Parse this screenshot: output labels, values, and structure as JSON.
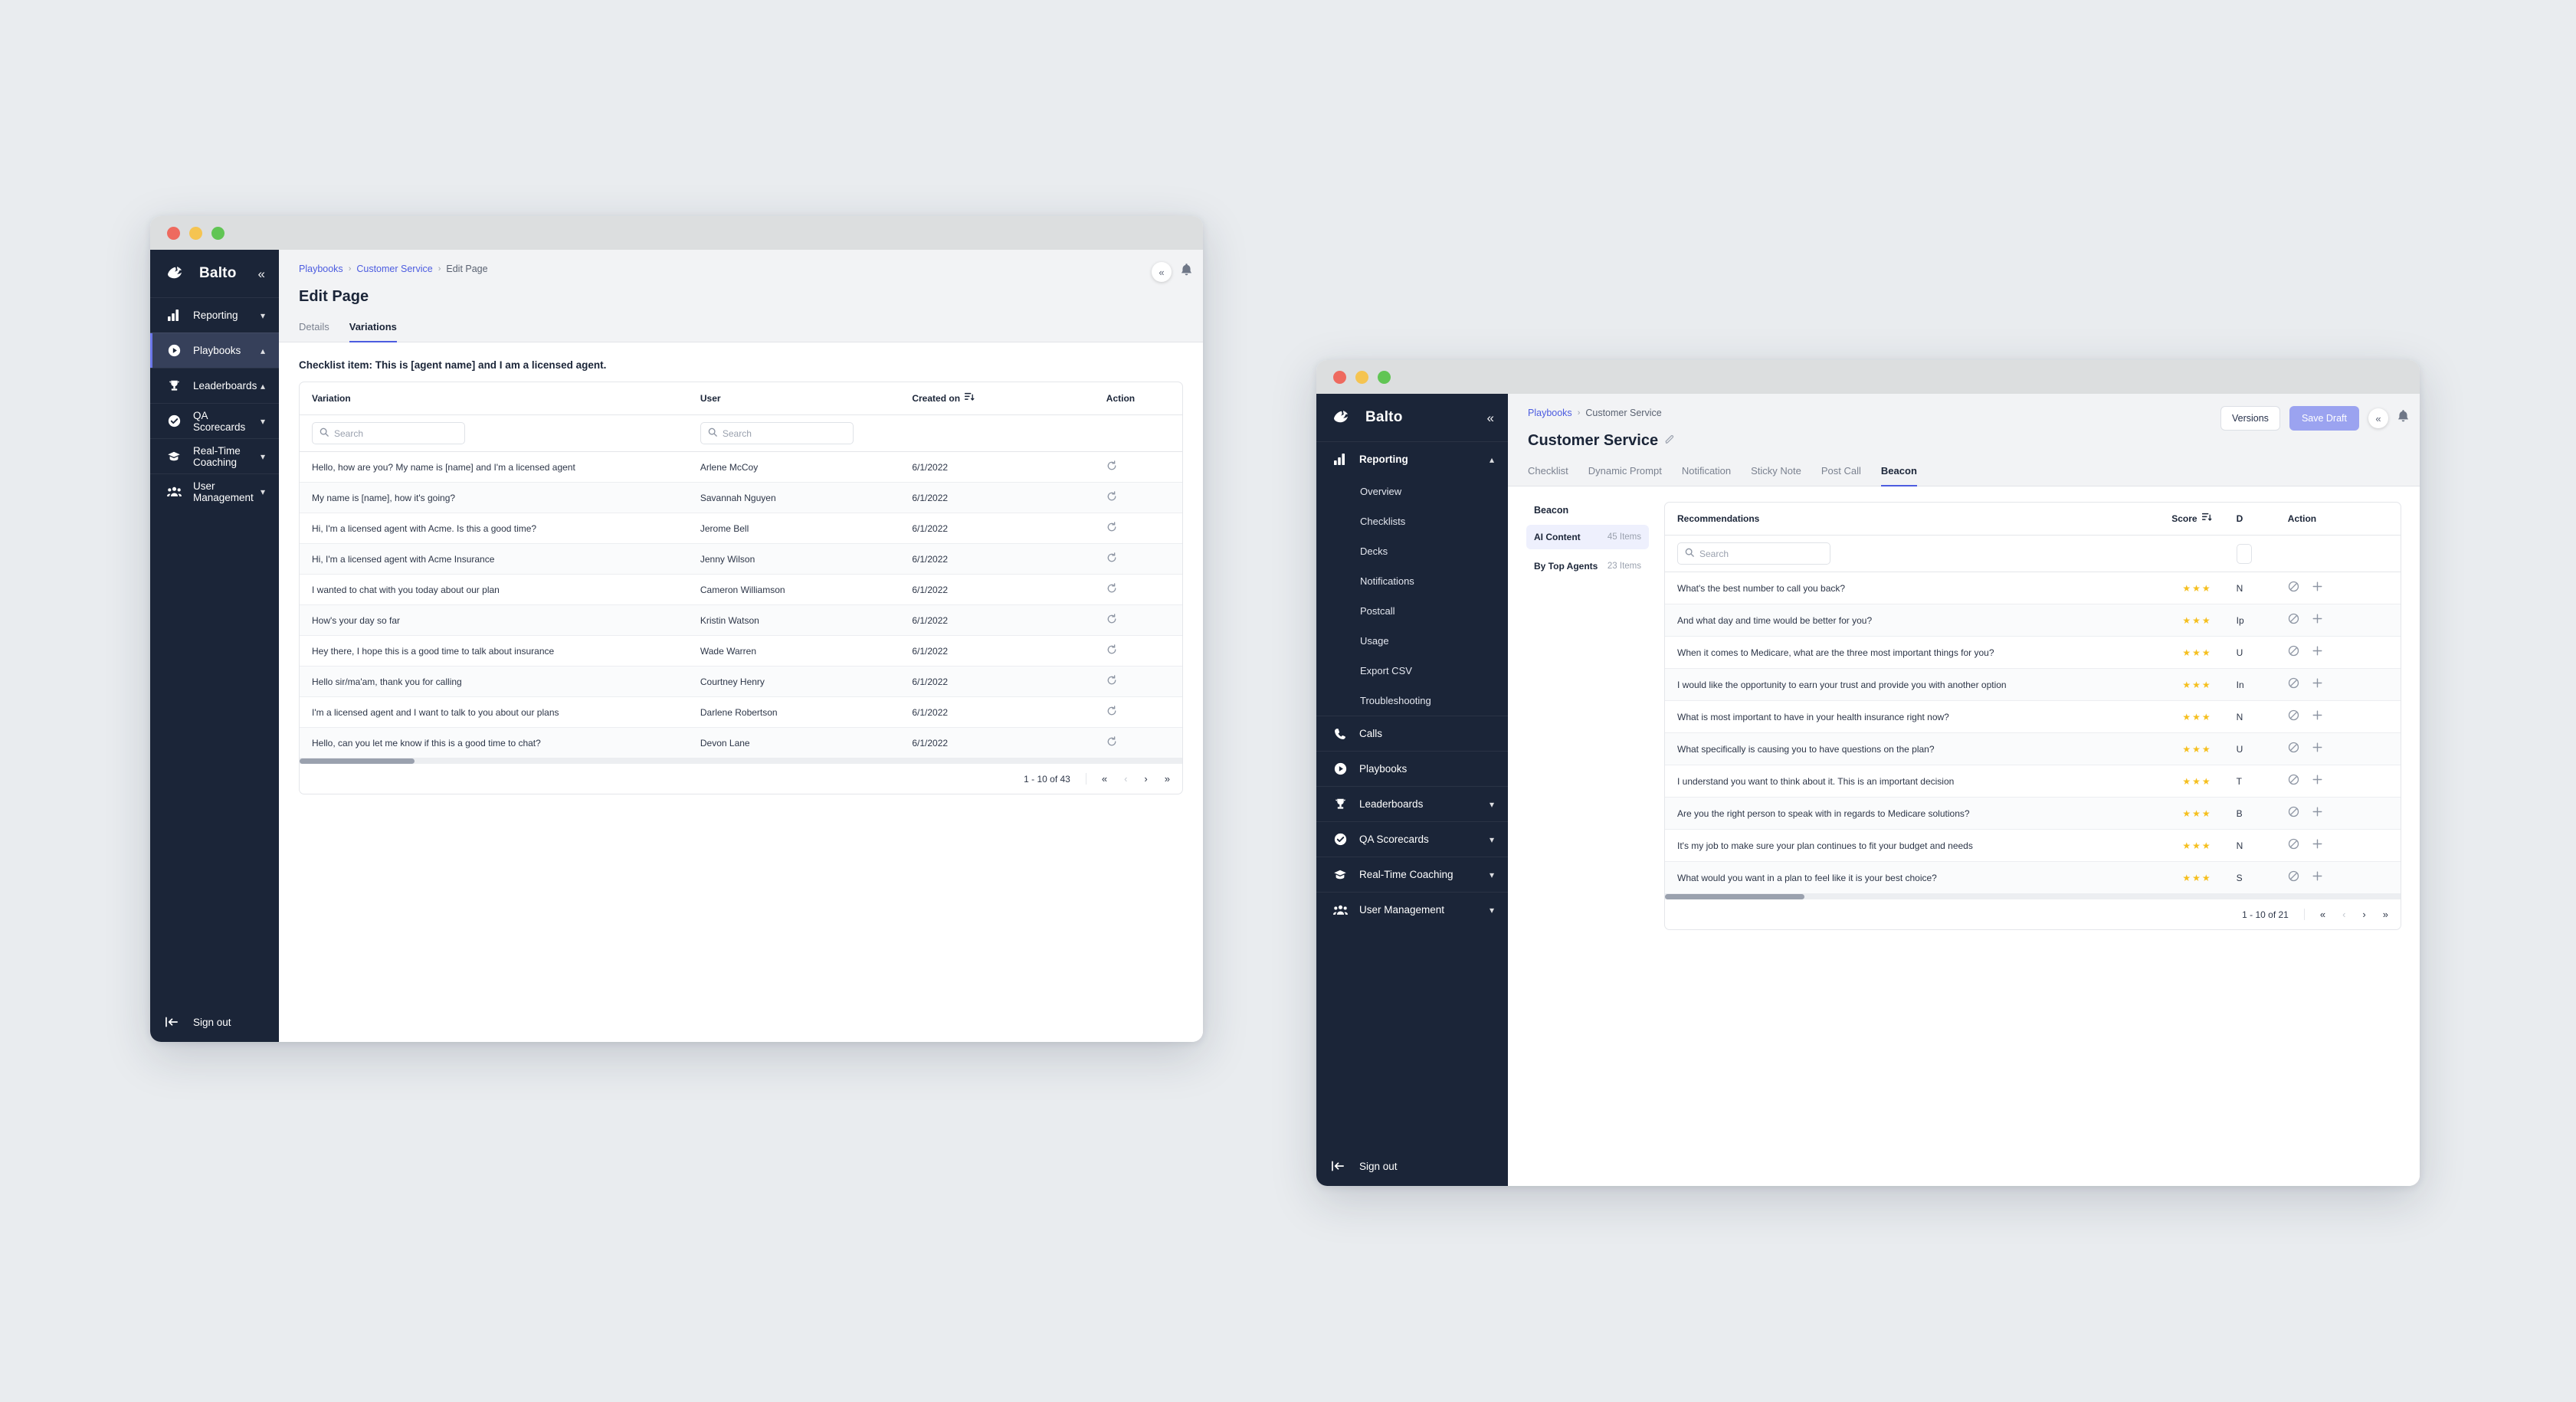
{
  "brand": {
    "name": "Balto",
    "logo_icon": "balto-wolf-logo"
  },
  "window_left": {
    "sidebar": {
      "collapse_icon": "chevron-double-left-icon",
      "items": [
        {
          "label": "Reporting",
          "icon": "bar-chart-icon",
          "chevron": "chevron-down-icon",
          "active": false
        },
        {
          "label": "Playbooks",
          "icon": "play-circle-icon",
          "chevron": "chevron-up-icon",
          "active": true
        },
        {
          "label": "Leaderboards",
          "icon": "trophy-icon",
          "chevron": "chevron-up-icon",
          "active": false
        },
        {
          "label": "QA Scorecards",
          "icon": "check-circle-icon",
          "chevron": "chevron-down-icon",
          "active": false
        },
        {
          "label": "Real-Time Coaching",
          "icon": "graduation-cap-icon",
          "chevron": "chevron-down-icon",
          "active": false
        },
        {
          "label": "User Management",
          "icon": "users-icon",
          "chevron": "chevron-down-icon",
          "active": false
        }
      ],
      "signout": {
        "label": "Sign out",
        "icon": "sign-out-icon"
      }
    },
    "breadcrumb": {
      "first": "Playbooks",
      "second": "Customer Service",
      "current": "Edit Page",
      "separator": "›"
    },
    "page_title": "Edit Page",
    "tabs": [
      {
        "label": "Details",
        "active": false
      },
      {
        "label": "Variations",
        "active": true
      }
    ],
    "topright": {
      "collapse_icon": "chevron-double-left-icon",
      "bell_icon": "bell-icon"
    },
    "checklist_title": "Checklist item: This is [agent name] and I am a licensed agent.",
    "table": {
      "columns": [
        "Variation",
        "User",
        "Created on",
        "Action"
      ],
      "sort_icon": "sort-descending-icon",
      "search_placeholder": "Search",
      "action_icon": "restore-icon",
      "rows": [
        {
          "variation": "Hello, how are you? My name is [name] and I'm a licensed agent",
          "user": "Arlene McCoy",
          "created": "6/1/2022"
        },
        {
          "variation": "My name is [name], how it's going?",
          "user": "Savannah Nguyen",
          "created": "6/1/2022"
        },
        {
          "variation": "Hi, I'm a licensed agent with Acme. Is this a good time?",
          "user": "Jerome Bell",
          "created": "6/1/2022"
        },
        {
          "variation": "Hi, I'm a licensed agent with Acme Insurance",
          "user": "Jenny Wilson",
          "created": "6/1/2022"
        },
        {
          "variation": "I wanted to chat with you today about our plan",
          "user": "Cameron Williamson",
          "created": "6/1/2022"
        },
        {
          "variation": "How's your day so far",
          "user": "Kristin Watson",
          "created": "6/1/2022"
        },
        {
          "variation": "Hey there, I hope this is a good time to talk about insurance",
          "user": "Wade Warren",
          "created": "6/1/2022"
        },
        {
          "variation": "Hello sir/ma'am, thank you for calling",
          "user": "Courtney Henry",
          "created": "6/1/2022"
        },
        {
          "variation": "I'm a licensed agent and I want to talk to you about our plans",
          "user": "Darlene Robertson",
          "created": "6/1/2022"
        },
        {
          "variation": "Hello, can you let me know if this is a good time to chat?",
          "user": "Devon Lane",
          "created": "6/1/2022"
        }
      ],
      "pagination": {
        "count_label": "1 - 10 of 43",
        "first": "«",
        "prev": "‹",
        "next": "›",
        "last": "»"
      }
    }
  },
  "window_right": {
    "sidebar": {
      "collapse_icon": "chevron-double-left-icon",
      "items": [
        {
          "label": "Reporting",
          "icon": "bar-chart-icon",
          "chevron": "chevron-up-icon",
          "active": true,
          "expanded": true,
          "children": [
            "Overview",
            "Checklists",
            "Decks",
            "Notifications",
            "Postcall",
            "Usage",
            "Export CSV",
            "Troubleshooting"
          ]
        },
        {
          "label": "Calls",
          "icon": "phone-icon",
          "chevron": "",
          "active": false
        },
        {
          "label": "Playbooks",
          "icon": "play-circle-icon",
          "chevron": "",
          "active": false
        },
        {
          "label": "Leaderboards",
          "icon": "trophy-icon",
          "chevron": "chevron-down-icon",
          "active": false
        },
        {
          "label": "QA Scorecards",
          "icon": "check-circle-icon",
          "chevron": "chevron-down-icon",
          "active": false
        },
        {
          "label": "Real-Time Coaching",
          "icon": "graduation-cap-icon",
          "chevron": "chevron-down-icon",
          "active": false
        },
        {
          "label": "User Management",
          "icon": "users-icon",
          "chevron": "chevron-down-icon",
          "active": false
        }
      ],
      "signout": {
        "label": "Sign out",
        "icon": "sign-out-icon"
      }
    },
    "breadcrumb": {
      "first": "Playbooks",
      "current": "Customer Service",
      "separator": "›"
    },
    "page_title": "Customer Service",
    "page_title_edit_icon": "pencil-icon",
    "buttons": {
      "versions": "Versions",
      "save_draft": "Save Draft"
    },
    "topright": {
      "collapse_icon": "chevron-double-left-icon",
      "bell_icon": "bell-icon"
    },
    "tabs": [
      {
        "label": "Checklist",
        "active": false
      },
      {
        "label": "Dynamic Prompt",
        "active": false
      },
      {
        "label": "Notification",
        "active": false
      },
      {
        "label": "Sticky Note",
        "active": false
      },
      {
        "label": "Post Call",
        "active": false
      },
      {
        "label": "Beacon",
        "active": true
      }
    ],
    "beacon_panel": {
      "heading": "Beacon",
      "items": [
        {
          "label": "AI Content",
          "count": "45 Items",
          "selected": true
        },
        {
          "label": "By Top Agents",
          "count": "23 Items",
          "selected": false
        }
      ]
    },
    "table": {
      "columns": [
        "Recommendations",
        "Score",
        "D",
        "Action"
      ],
      "sort_icon": "sort-descending-icon",
      "search_placeholder": "Search",
      "action_icons": [
        "block-icon",
        "plus-icon"
      ],
      "star_glyph": "★",
      "rows": [
        {
          "text": "What's the best number to call you back?",
          "score": 3,
          "d": "N"
        },
        {
          "text": "And what day and time would be better for you?",
          "score": 3,
          "d": "Ip"
        },
        {
          "text": "When it comes to Medicare, what are the three most important things for you?",
          "score": 3,
          "d": "U"
        },
        {
          "text": "I would like the opportunity to earn your trust and provide you with another option",
          "score": 3,
          "d": "In"
        },
        {
          "text": "What is most important to have in your health insurance right now?",
          "score": 3,
          "d": "N"
        },
        {
          "text": "What specifically is causing you to have questions on the plan?",
          "score": 3,
          "d": "U"
        },
        {
          "text": "I understand you want to think about it. This is an important decision",
          "score": 3,
          "d": "T"
        },
        {
          "text": "Are you the right person to speak with in regards to Medicare solutions?",
          "score": 3,
          "d": "B"
        },
        {
          "text": "It's my job to make sure your plan continues to fit your budget and needs",
          "score": 3,
          "d": "N"
        },
        {
          "text": "What would you want in a plan to feel like it is your best choice?",
          "score": 3,
          "d": "S"
        }
      ],
      "pagination": {
        "count_label": "1 - 10 of 21",
        "first": "«",
        "prev": "‹",
        "next": "›",
        "last": "»"
      }
    }
  },
  "colors": {
    "sidebar_bg": "#1b2538",
    "sidebar_active": "#36405a",
    "accent": "#4c5ce0",
    "primary_button": "#9ba3f0",
    "star": "#f5bf1e",
    "page_bg": "#e9ecef"
  }
}
